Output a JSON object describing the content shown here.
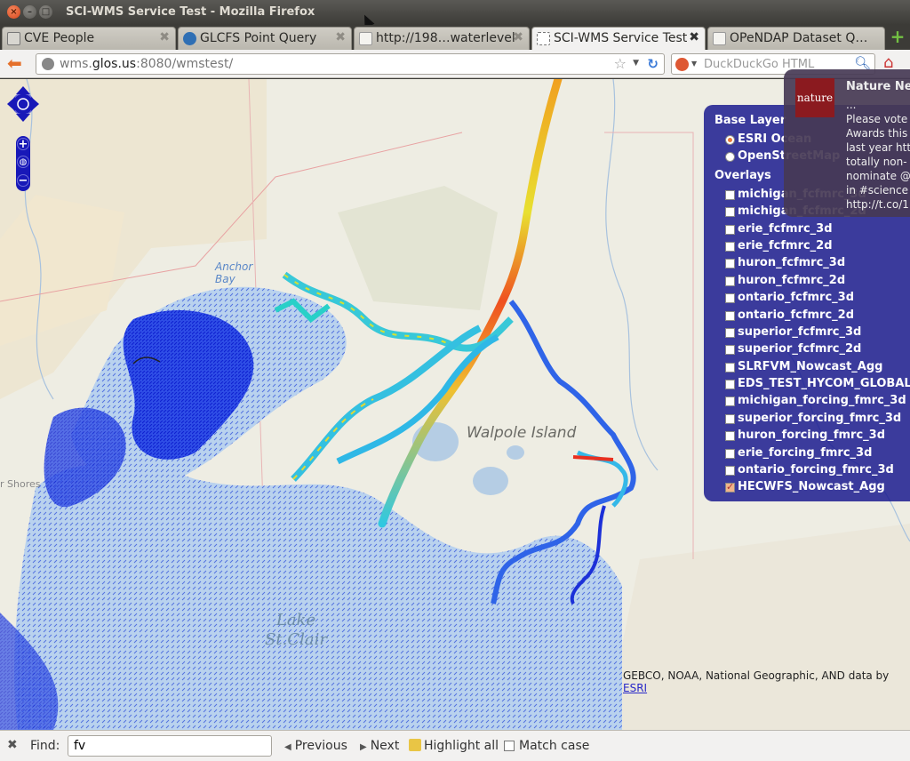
{
  "window": {
    "title": "SCI-WMS Service Test - Mozilla Firefox"
  },
  "tabs": [
    {
      "label": "CVE People"
    },
    {
      "label": "GLCFS Point Query"
    },
    {
      "label": "http://198…waterlevel"
    },
    {
      "label": "SCI-WMS Service Test"
    },
    {
      "label": "OPeNDAP Dataset Q…"
    }
  ],
  "nav": {
    "url_host": "wms.",
    "url_domain": "glos.us",
    "url_rest": ":8080/wmstest/",
    "search_placeholder": "DuckDuckGo HTML"
  },
  "map": {
    "labels": {
      "lake_line1": "Lake",
      "lake_line2": "St.Clair",
      "walpole": "Walpole Island",
      "shores": "r Shores",
      "anchor_line1": "Anchor",
      "anchor_line2": "Bay"
    },
    "zoom_in": "+",
    "zoom_out": "−",
    "attribution_text": "GEBCO, NOAA, National Geographic, AND data by",
    "attribution_link": "ESRI"
  },
  "layer_switcher": {
    "base_heading": "Base Layer",
    "base_layers": [
      {
        "label": "ESRI Ocean",
        "selected": true
      },
      {
        "label": "OpenStreetMap",
        "selected": false
      }
    ],
    "overlay_heading": "Overlays",
    "overlays": [
      {
        "label": "michigan_fcfmrc_3d",
        "checked": false
      },
      {
        "label": "michigan_fcfmrc_2d",
        "checked": false
      },
      {
        "label": "erie_fcfmrc_3d",
        "checked": false
      },
      {
        "label": "erie_fcfmrc_2d",
        "checked": false
      },
      {
        "label": "huron_fcfmrc_3d",
        "checked": false
      },
      {
        "label": "huron_fcfmrc_2d",
        "checked": false
      },
      {
        "label": "ontario_fcfmrc_3d",
        "checked": false
      },
      {
        "label": "ontario_fcfmrc_2d",
        "checked": false
      },
      {
        "label": "superior_fcfmrc_3d",
        "checked": false
      },
      {
        "label": "superior_fcfmrc_2d",
        "checked": false
      },
      {
        "label": "SLRFVM_Nowcast_Agg",
        "checked": false
      },
      {
        "label": "EDS_TEST_HYCOM_GLOBAL",
        "checked": false
      },
      {
        "label": "michigan_forcing_fmrc_3d",
        "checked": false
      },
      {
        "label": "superior_forcing_fmrc_3d",
        "checked": false
      },
      {
        "label": "huron_forcing_fmrc_3d",
        "checked": false
      },
      {
        "label": "erie_forcing_fmrc_3d",
        "checked": false
      },
      {
        "label": "ontario_forcing_fmrc_3d",
        "checked": false
      },
      {
        "label": "HECWFS_Nowcast_Agg",
        "checked": true
      }
    ]
  },
  "notification": {
    "logo_text": "nature",
    "title": "Nature Ne",
    "body": "...\nPlease vote\nAwards this y\nlast year htt\ntotally non-\nnominate @r\nin #science b\nhttp://t.co/1"
  },
  "findbar": {
    "label": "Find:",
    "value": "fv",
    "previous": "Previous",
    "next": "Next",
    "highlight": "Highlight all",
    "match_case": "Match case"
  }
}
